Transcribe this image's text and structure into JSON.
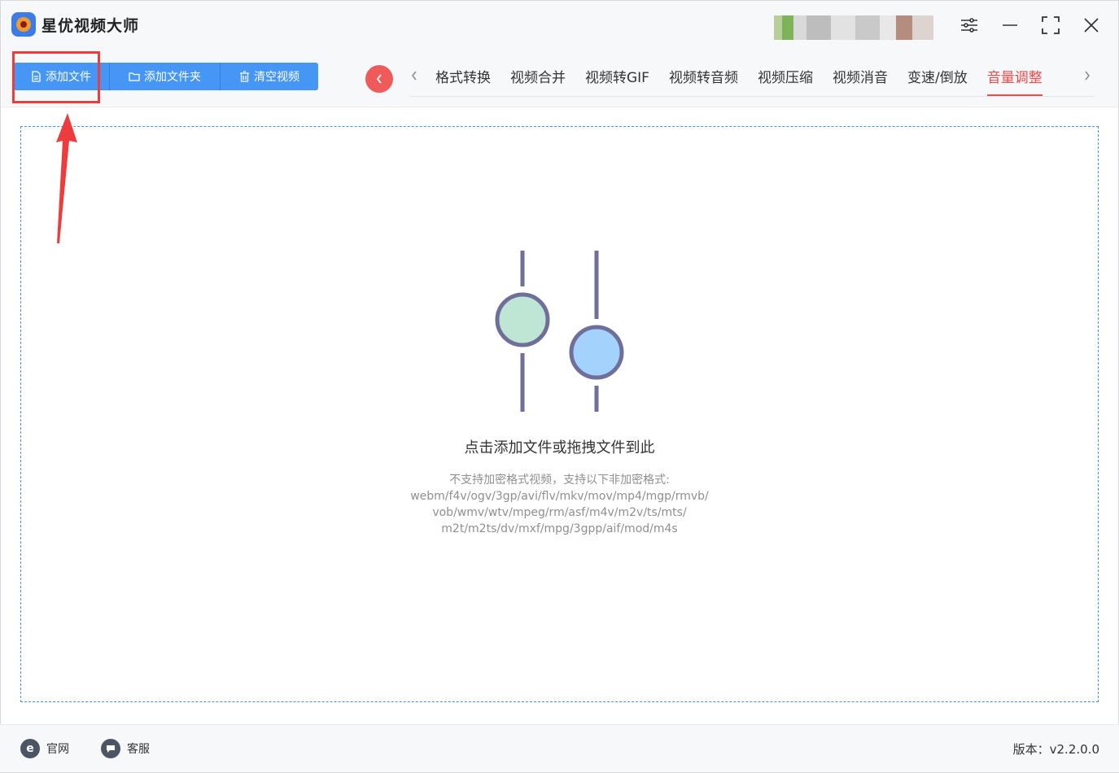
{
  "app": {
    "title": "星优视频大师"
  },
  "toolbar": {
    "add_file": "添加文件",
    "add_folder": "添加文件夹",
    "clear_video": "清空视频"
  },
  "tabs": [
    {
      "label": "格式转换"
    },
    {
      "label": "视频合并"
    },
    {
      "label": "视频转GIF"
    },
    {
      "label": "视频转音频"
    },
    {
      "label": "视频压缩"
    },
    {
      "label": "视频消音"
    },
    {
      "label": "变速/倒放"
    },
    {
      "label": "音量调整",
      "active": true
    }
  ],
  "dropzone": {
    "title": "点击添加文件或拖拽文件到此",
    "hint_line1": "不支持加密格式视频，支持以下非加密格式:",
    "hint_line2": "webm/f4v/ogv/3gp/avi/flv/mkv/mov/mp4/mgp/rmvb/",
    "hint_line3": "vob/wmv/wtv/mpeg/rm/asf/m4v/m2v/ts/mts/",
    "hint_line4": "m2t/m2ts/dv/mxf/mpg/3gpp/aif/mod/m4s"
  },
  "footer": {
    "website": "官网",
    "support": "客服",
    "version": "版本：v2.2.0.0"
  },
  "colors": {
    "accent": "#4596f5",
    "active_tab": "#e84c4c",
    "annotation": "#ee3b3b"
  }
}
